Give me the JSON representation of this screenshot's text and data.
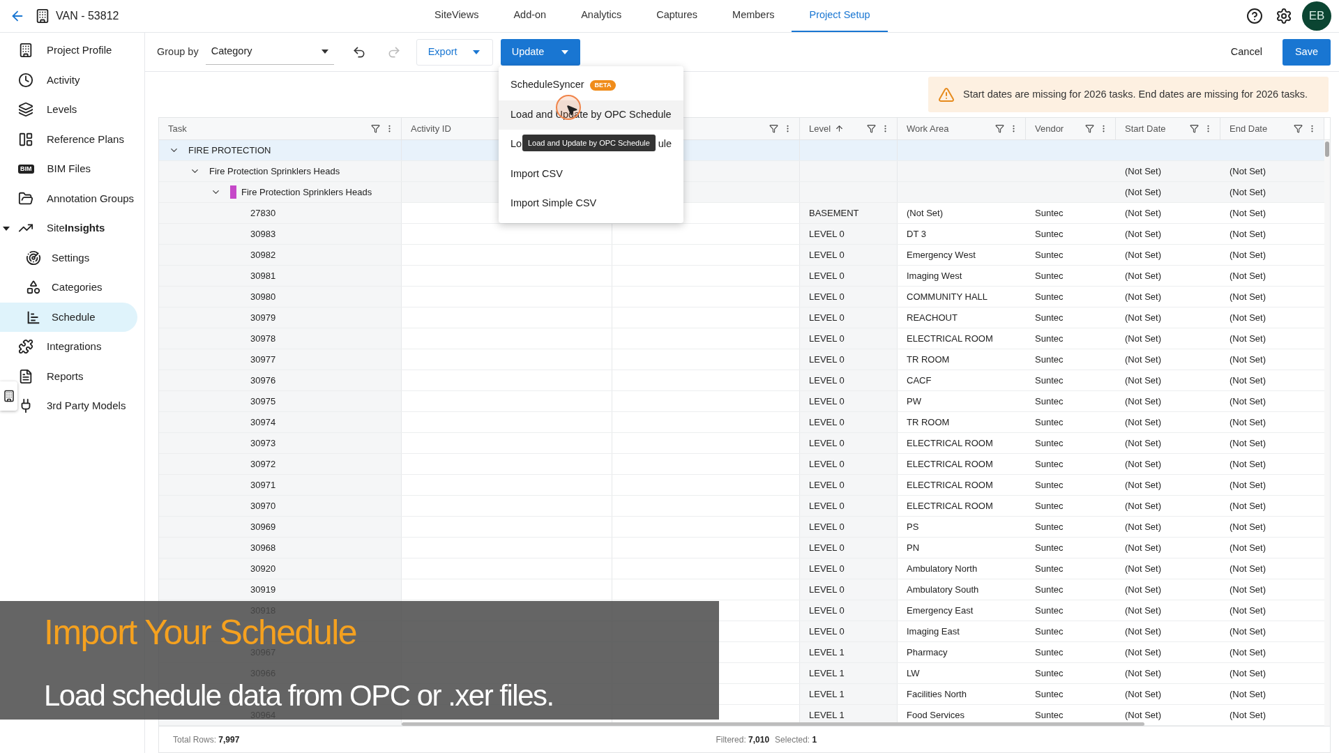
{
  "header": {
    "title": "VAN - 53812",
    "avatar": "EB"
  },
  "tabs": [
    {
      "label": "SiteViews",
      "selected": false
    },
    {
      "label": "Add-on",
      "selected": false
    },
    {
      "label": "Analytics",
      "selected": false
    },
    {
      "label": "Captures",
      "selected": false
    },
    {
      "label": "Members",
      "selected": false
    },
    {
      "label": "Project Setup",
      "selected": true
    }
  ],
  "sidebar": {
    "items": [
      {
        "label": "Project Profile",
        "selected": false
      },
      {
        "label": "Activity",
        "selected": false
      },
      {
        "label": "Levels",
        "selected": false
      },
      {
        "label": "Reference Plans",
        "selected": false
      },
      {
        "icon_text": "BIM",
        "label": "BIM Files",
        "selected": false
      },
      {
        "label": "Annotation Groups",
        "selected": false
      },
      {
        "label": "Site**Insights**",
        "selected": false,
        "expanded": true,
        "children": [
          {
            "label": "Settings",
            "selected": false
          },
          {
            "label": "Categories",
            "selected": false
          },
          {
            "label": "Schedule",
            "selected": true
          }
        ]
      },
      {
        "label": "Integrations",
        "selected": false
      },
      {
        "label": "Reports",
        "selected": false
      },
      {
        "label": "3rd Party Models",
        "selected": false
      }
    ]
  },
  "toolbar": {
    "group_by_label": "Group by",
    "group_by_value": "Category",
    "undo_disabled": false,
    "redo_disabled": true,
    "export": "Export",
    "update": "Update",
    "cancel": "Cancel",
    "save": "Save"
  },
  "update_menu": {
    "items": [
      {
        "label": "ScheduleSyncer",
        "badge": "BETA",
        "highlighted": false
      },
      {
        "label": "Load and Update by OPC Schedule",
        "highlighted": true
      },
      {
        "label_start": "Lo",
        "label_end": "ule",
        "highlighted": false
      },
      {
        "label": "Import CSV",
        "highlighted": false
      },
      {
        "label": "Import Simple CSV",
        "highlighted": false
      }
    ],
    "tooltip": "Load and Update by OPC Schedule"
  },
  "warning": "Start dates are missing for 2026 tasks. End dates are missing for 2026 tasks.",
  "table": {
    "columns": [
      {
        "label": "Task",
        "controls": true
      },
      {
        "label": "Activity ID"
      },
      {
        "controls": true
      },
      {
        "label": "Level",
        "sort_ascending": true,
        "controls": true
      },
      {
        "label": "Work Area",
        "controls": true
      },
      {
        "label": "Vendor",
        "controls": true
      },
      {
        "label": "Start Date",
        "controls": true
      },
      {
        "label": "End Date",
        "controls": true
      }
    ],
    "rows": [
      {
        "kind": "group",
        "task": "FIRE PROTECTION",
        "expanded": true,
        "selected": true,
        "children": [
          {
            "kind": "group",
            "task": "Fire Protection Sprinklers Heads",
            "expanded": true,
            "selected": false,
            "start_date": "(Not Set)",
            "end_date": "(Not Set)",
            "children": [
              {
                "kind": "group",
                "task": "Fire Protection Sprinklers Heads",
                "color": "#c548c8",
                "expanded": true,
                "selected": false,
                "start_date": "(Not Set)",
                "end_date": "(Not Set)",
                "children": [
                  {
                    "kind": "task",
                    "task": "27830",
                    "level": "BASEMENT",
                    "work_area": "(Not Set)",
                    "vendor": "Suntec",
                    "start_date": "(Not Set)",
                    "end_date": "(Not Set)",
                    "selected": false
                  },
                  {
                    "kind": "task",
                    "task": "30983",
                    "level": "LEVEL 0",
                    "work_area": "DT 3",
                    "vendor": "Suntec",
                    "start_date": "(Not Set)",
                    "end_date": "(Not Set)",
                    "selected": false
                  },
                  {
                    "kind": "task",
                    "task": "30982",
                    "level": "LEVEL 0",
                    "work_area": "Emergency West",
                    "vendor": "Suntec",
                    "start_date": "(Not Set)",
                    "end_date": "(Not Set)",
                    "selected": false
                  },
                  {
                    "kind": "task",
                    "task": "30981",
                    "level": "LEVEL 0",
                    "work_area": "Imaging West",
                    "vendor": "Suntec",
                    "start_date": "(Not Set)",
                    "end_date": "(Not Set)",
                    "selected": false
                  },
                  {
                    "kind": "task",
                    "task": "30980",
                    "level": "LEVEL 0",
                    "work_area": "COMMUNITY HALL",
                    "vendor": "Suntec",
                    "start_date": "(Not Set)",
                    "end_date": "(Not Set)",
                    "selected": false
                  },
                  {
                    "kind": "task",
                    "task": "30979",
                    "level": "LEVEL 0",
                    "work_area": "REACHOUT",
                    "vendor": "Suntec",
                    "start_date": "(Not Set)",
                    "end_date": "(Not Set)",
                    "selected": false
                  },
                  {
                    "kind": "task",
                    "task": "30978",
                    "level": "LEVEL 0",
                    "work_area": "ELECTRICAL ROOM",
                    "vendor": "Suntec",
                    "start_date": "(Not Set)",
                    "end_date": "(Not Set)",
                    "selected": false
                  },
                  {
                    "kind": "task",
                    "task": "30977",
                    "level": "LEVEL 0",
                    "work_area": "TR ROOM",
                    "vendor": "Suntec",
                    "start_date": "(Not Set)",
                    "end_date": "(Not Set)",
                    "selected": false
                  },
                  {
                    "kind": "task",
                    "task": "30976",
                    "level": "LEVEL 0",
                    "work_area": "CACF",
                    "vendor": "Suntec",
                    "start_date": "(Not Set)",
                    "end_date": "(Not Set)",
                    "selected": false
                  },
                  {
                    "kind": "task",
                    "task": "30975",
                    "level": "LEVEL 0",
                    "work_area": "PW",
                    "vendor": "Suntec",
                    "start_date": "(Not Set)",
                    "end_date": "(Not Set)",
                    "selected": false
                  },
                  {
                    "kind": "task",
                    "task": "30974",
                    "level": "LEVEL 0",
                    "work_area": "TR ROOM",
                    "vendor": "Suntec",
                    "start_date": "(Not Set)",
                    "end_date": "(Not Set)",
                    "selected": false
                  },
                  {
                    "kind": "task",
                    "task": "30973",
                    "level": "LEVEL 0",
                    "work_area": "ELECTRICAL ROOM",
                    "vendor": "Suntec",
                    "start_date": "(Not Set)",
                    "end_date": "(Not Set)",
                    "selected": false
                  },
                  {
                    "kind": "task",
                    "task": "30972",
                    "level": "LEVEL 0",
                    "work_area": "ELECTRICAL ROOM",
                    "vendor": "Suntec",
                    "start_date": "(Not Set)",
                    "end_date": "(Not Set)",
                    "selected": false
                  },
                  {
                    "kind": "task",
                    "task": "30971",
                    "level": "LEVEL 0",
                    "work_area": "ELECTRICAL ROOM",
                    "vendor": "Suntec",
                    "start_date": "(Not Set)",
                    "end_date": "(Not Set)",
                    "selected": false
                  },
                  {
                    "kind": "task",
                    "task": "30970",
                    "level": "LEVEL 0",
                    "work_area": "ELECTRICAL ROOM",
                    "vendor": "Suntec",
                    "start_date": "(Not Set)",
                    "end_date": "(Not Set)",
                    "selected": false
                  },
                  {
                    "kind": "task",
                    "task": "30969",
                    "level": "LEVEL 0",
                    "work_area": "PS",
                    "vendor": "Suntec",
                    "start_date": "(Not Set)",
                    "end_date": "(Not Set)",
                    "selected": false
                  },
                  {
                    "kind": "task",
                    "task": "30968",
                    "level": "LEVEL 0",
                    "work_area": "PN",
                    "vendor": "Suntec",
                    "start_date": "(Not Set)",
                    "end_date": "(Not Set)",
                    "selected": false
                  },
                  {
                    "kind": "task",
                    "task": "30920",
                    "level": "LEVEL 0",
                    "work_area": "Ambulatory North",
                    "vendor": "Suntec",
                    "start_date": "(Not Set)",
                    "end_date": "(Not Set)",
                    "selected": false
                  },
                  {
                    "kind": "task",
                    "task": "30919",
                    "level": "LEVEL 0",
                    "work_area": "Ambulatory South",
                    "vendor": "Suntec",
                    "start_date": "(Not Set)",
                    "end_date": "(Not Set)",
                    "selected": false
                  },
                  {
                    "kind": "task",
                    "task": "30918",
                    "level": "LEVEL 0",
                    "work_area": "Emergency East",
                    "vendor": "Suntec",
                    "start_date": "(Not Set)",
                    "end_date": "(Not Set)",
                    "selected": false
                  },
                  {
                    "kind": "task",
                    "level": "LEVEL 0",
                    "work_area": "Imaging East",
                    "vendor": "Suntec",
                    "start_date": "(Not Set)",
                    "end_date": "(Not Set)",
                    "selected": false
                  },
                  {
                    "kind": "task",
                    "task": "30967",
                    "level": "LEVEL 1",
                    "work_area": "Pharmacy",
                    "vendor": "Suntec",
                    "start_date": "(Not Set)",
                    "end_date": "(Not Set)",
                    "selected": false
                  },
                  {
                    "kind": "task",
                    "task": "30966",
                    "level": "LEVEL 1",
                    "work_area": "LW",
                    "vendor": "Suntec",
                    "start_date": "(Not Set)",
                    "end_date": "(Not Set)",
                    "selected": false
                  },
                  {
                    "kind": "task",
                    "level": "LEVEL 1",
                    "work_area": "Facilities North",
                    "vendor": "Suntec",
                    "start_date": "(Not Set)",
                    "end_date": "(Not Set)",
                    "selected": false
                  },
                  {
                    "kind": "task",
                    "task": "30964",
                    "level": "LEVEL 1",
                    "work_area": "Food Services",
                    "vendor": "Suntec",
                    "start_date": "(Not Set)",
                    "end_date": "(Not Set)",
                    "selected": false
                  }
                ]
              }
            ]
          }
        ]
      }
    ]
  },
  "status": {
    "total": "Total Rows: **7,997**",
    "filtered": "Filtered: **7,010**",
    "selected": "Selected: **1**"
  },
  "banner": {
    "title": "Import Your Schedule",
    "subtitle": "Load schedule data from OPC or .xer files."
  }
}
